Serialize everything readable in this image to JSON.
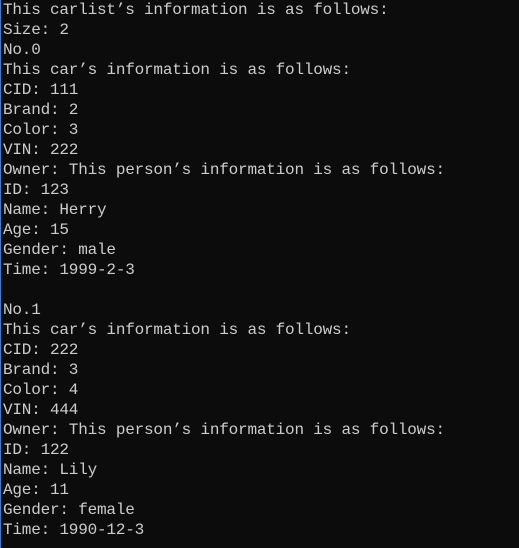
{
  "console": {
    "lines": [
      "This carlist’s information is as follows:",
      "Size: 2",
      "No.0",
      "This car’s information is as follows:",
      "CID: 111",
      "Brand: 2",
      "Color: 3",
      "VIN: 222",
      "Owner: This person’s information is as follows:",
      "ID: 123",
      "Name: Herry",
      "Age: 15",
      "Gender: male",
      "Time: 1999-2-3",
      "",
      "No.1",
      "This car’s information is as follows:",
      "CID: 222",
      "Brand: 3",
      "Color: 4",
      "VIN: 444",
      "Owner: This person’s information is as follows:",
      "ID: 122",
      "Name: Lily",
      "Age: 11",
      "Gender: female",
      "Time: 1990-12-3"
    ]
  }
}
